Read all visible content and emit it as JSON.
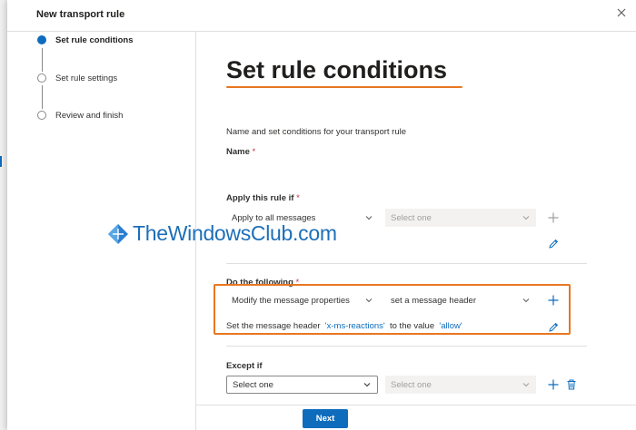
{
  "panel": {
    "title": "New transport rule"
  },
  "steps": [
    {
      "label": "Set rule conditions",
      "active": true
    },
    {
      "label": "Set rule settings",
      "active": false
    },
    {
      "label": "Review and finish",
      "active": false
    }
  ],
  "main": {
    "heading": "Set rule conditions",
    "subtitle": "Name and set conditions for your transport rule",
    "name_label": "Name",
    "required_marker": "*",
    "apply_if": {
      "label": "Apply this rule if",
      "condition": "Apply to all messages",
      "secondary_placeholder": "Select one"
    },
    "do_following": {
      "label": "Do the following",
      "action": "Modify the message properties",
      "subaction": "set a message header",
      "description": {
        "prefix": "Set the message header",
        "header_name": "'x-ms-reactions'",
        "middle": "to the value",
        "header_value": "'allow'"
      }
    },
    "except_if": {
      "label": "Except if",
      "placeholder": "Select one",
      "secondary_placeholder": "Select one"
    }
  },
  "footer": {
    "next_label": "Next"
  },
  "watermark": {
    "text": "TheWindowsClub.com"
  },
  "colors": {
    "accent": "#0f6cbd",
    "highlight": "#e87722",
    "required": "#c4314b"
  },
  "icons": [
    "close-icon",
    "chevron-down-icon",
    "add-icon",
    "edit-icon",
    "delete-icon"
  ]
}
